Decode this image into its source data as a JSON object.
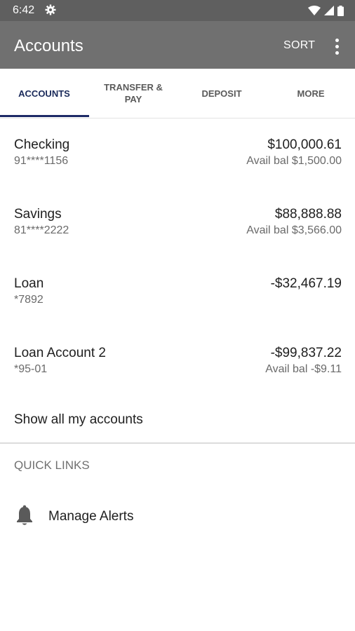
{
  "status_bar": {
    "time": "6:42"
  },
  "app_bar": {
    "title": "Accounts",
    "sort_label": "SORT"
  },
  "tabs": [
    {
      "label": "ACCOUNTS",
      "active": true
    },
    {
      "label": "TRANSFER & PAY",
      "active": false
    },
    {
      "label": "DEPOSIT",
      "active": false
    },
    {
      "label": "MORE",
      "active": false
    }
  ],
  "accounts": [
    {
      "name": "Checking",
      "number": "91****1156",
      "balance": "$100,000.61",
      "available": "Avail bal $1,500.00"
    },
    {
      "name": "Savings",
      "number": "81****2222",
      "balance": "$88,888.88",
      "available": "Avail bal $3,566.00"
    },
    {
      "name": "Loan",
      "number": "*7892",
      "balance": "-$32,467.19",
      "available": ""
    },
    {
      "name": "Loan Account 2",
      "number": "*95-01",
      "balance": "-$99,837.22",
      "available": "Avail bal -$9.11"
    }
  ],
  "show_all_label": "Show all my accounts",
  "quick_links": {
    "title": "QUICK LINKS",
    "items": [
      {
        "label": "Manage Alerts",
        "icon": "bell-icon"
      }
    ]
  },
  "colors": {
    "status_bar": "#5f5f5f",
    "app_bar": "#707070",
    "active_tab": "#1d2a66"
  }
}
